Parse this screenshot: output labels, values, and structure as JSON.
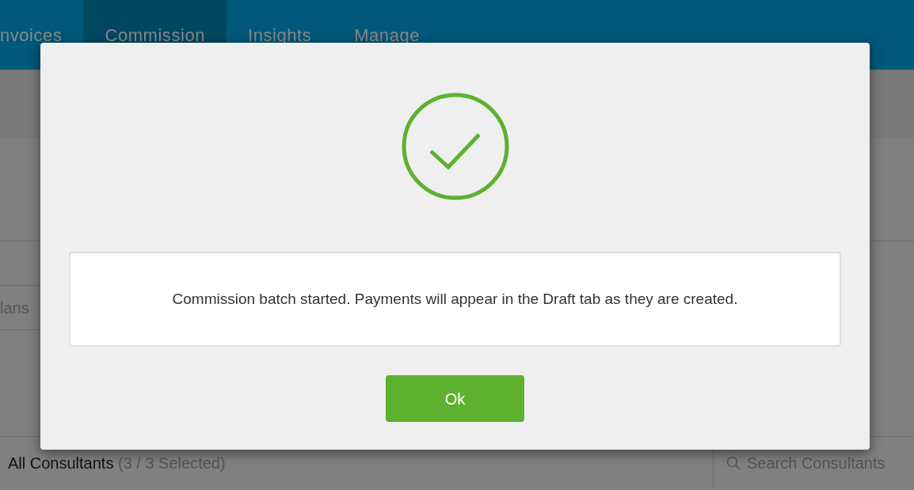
{
  "nav": {
    "tabs": [
      {
        "label": "nvoices",
        "selected": false
      },
      {
        "label": "Commission",
        "selected": true
      },
      {
        "label": "Insights",
        "selected": false
      },
      {
        "label": "Manage",
        "selected": false
      }
    ]
  },
  "plans_button": {
    "label": "lans"
  },
  "consultants": {
    "title": "All Consultants",
    "count": "(3 / 3 Selected)",
    "search": {
      "placeholder": "Search Consultants"
    }
  },
  "dialog": {
    "message": "Commission batch started. Payments will appear in the Draft tab as they are created.",
    "button": "Ok"
  }
}
